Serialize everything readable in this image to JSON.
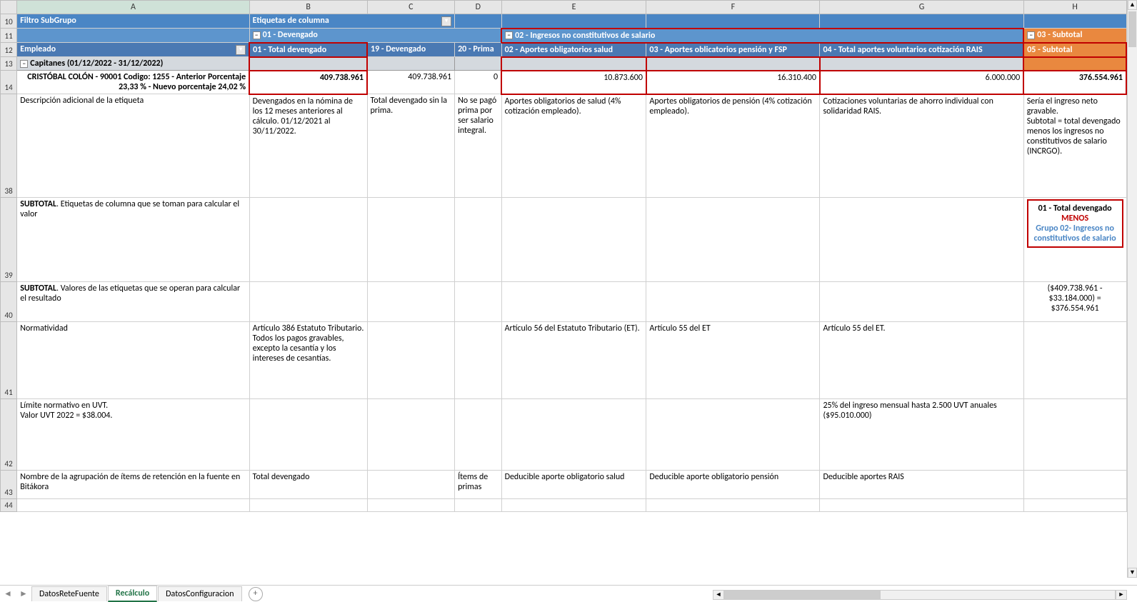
{
  "columns": [
    "A",
    "B",
    "C",
    "D",
    "E",
    "F",
    "G",
    "H"
  ],
  "rows": [
    "10",
    "11",
    "12",
    "13",
    "14",
    "38",
    "39",
    "40",
    "41",
    "42",
    "43",
    "44"
  ],
  "row10": {
    "A": "Filtro SubGrupo",
    "B": "Etiquetas de columna"
  },
  "row11": {
    "B_exp": "−",
    "B": "01 - Devengado",
    "E_exp": "−",
    "E": "02 - Ingresos no constitutivos de salario",
    "H_exp": "−",
    "H": "03 - Subtotal"
  },
  "row12": {
    "A": "Empleado",
    "B": "01 - Total devengado",
    "C": "19 - Devengado",
    "D": "20 - Prima",
    "E": "02 - Aportes obligatorios salud",
    "F": "03 - Aportes oblicatorios pensión y FSP",
    "G": "04 - Total aportes voluntarios cotización RAIS",
    "H": "05 - Subtotal"
  },
  "row13": {
    "A_exp": "−",
    "A": "Capitanes (01/12/2022 - 31/12/2022)"
  },
  "row14": {
    "A": "CRISTÓBAL COLÓN - 90001 Codigo: 1255 - Anterior Porcentaje  23,33 % - Nuevo porcentaje  24,02 %",
    "B": "409.738.961",
    "C": "409.738.961",
    "D": "0",
    "E": "10.873.600",
    "F": "16.310.400",
    "G": "6.000.000",
    "H": "376.554.961"
  },
  "row38": {
    "A": "Descripción adicional de la etiqueta",
    "B": "Devengados en la nómina de los 12 meses anteriores al cálculo. 01/12/2021 al 30/11/2022.",
    "C": "Total devengado sin la prima.",
    "D": "No se pagó prima por ser salario integral.",
    "E": "Aportes obligatorios de salud (4% cotización empleado).",
    "F": "Aportes obligatorios de pensión  (4% cotización empleado).",
    "G": "Cotizaciones voluntarias de ahorro individual con solidaridad RAIS.",
    "H": "Sería el ingreso neto gravable.\nSubtotal = total devengado menos los ingresos no constitutivos de salario (INCRGO)."
  },
  "row39": {
    "A_pre": "SUBTOTAL",
    "A": ". Etiquetas de columna que se toman para calcular el valor",
    "H1": "01 - Total devengado",
    "H2": "MENOS",
    "H3": "Grupo 02- Ingresos no constitutivos de salario"
  },
  "row40": {
    "A_pre": "SUBTOTAL",
    "A": ". Valores de las etiquetas que se operan para calcular el resultado",
    "H": "($409.738.961 - $33.184.000) = $376.554.961"
  },
  "row41": {
    "A": "Normatividad",
    "B": "Artículo 386 Estatuto Tributario. Todos los pagos gravables, excepto la cesantía y los intereses de cesantías.",
    "E": "Artículo 56 del Estatuto Tributario (ET).",
    "F": "Artículo 55 del ET",
    "G": "Artículo 55 del ET."
  },
  "row42": {
    "A": "Límite normativo en UVT.\nValor UVT 2022 = $38.004.",
    "G": "25% del ingreso mensual hasta 2.500 UVT anuales ($95.010.000)"
  },
  "row43": {
    "A": "Nombre de la agrupación de ítems de retención en la fuente en Bitákora",
    "B": "Total devengado",
    "D": "Ítems de primas",
    "E": "Deducible aporte obligatorio salud",
    "F": "Deducible aporte obligatorio pensión",
    "G": "Deducible aportes RAIS"
  },
  "tabs": {
    "t1": "DatosReteFuente",
    "t2": "Recálculo",
    "t3": "DatosConfiguracion"
  }
}
